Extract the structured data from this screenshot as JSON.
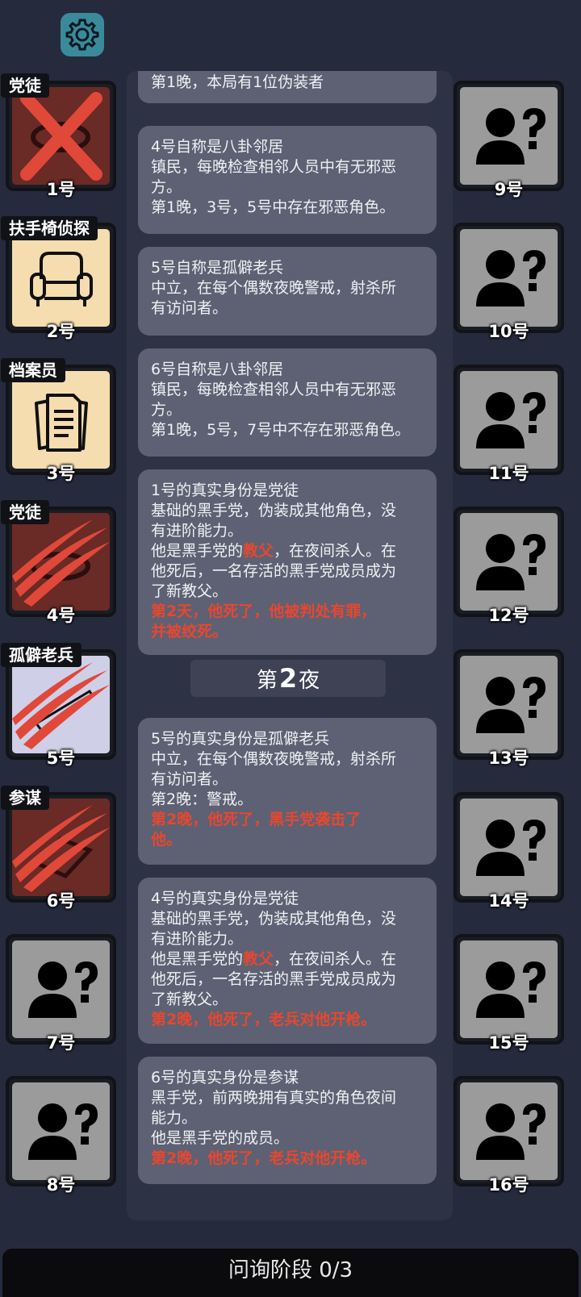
{
  "settings_icon": "gear-icon",
  "left_players": [
    {
      "num": "1号",
      "tag": "党徒",
      "status": "executed"
    },
    {
      "num": "2号",
      "tag": "扶手椅侦探",
      "status": "alive"
    },
    {
      "num": "3号",
      "tag": "档案员",
      "status": "alive"
    },
    {
      "num": "4号",
      "tag": "党徒",
      "status": "dead"
    },
    {
      "num": "5号",
      "tag": "孤僻老兵",
      "status": "dead"
    },
    {
      "num": "6号",
      "tag": "参谋",
      "status": "dead"
    },
    {
      "num": "7号",
      "tag": "",
      "status": "unknown"
    },
    {
      "num": "8号",
      "tag": "",
      "status": "unknown"
    }
  ],
  "right_players": [
    "9号",
    "10号",
    "11号",
    "12号",
    "13号",
    "14号",
    "15号",
    "16号"
  ],
  "messages": [
    {
      "lines": [
        "第1晚，本局有1位伪装者"
      ]
    },
    {
      "lines": [
        "4号自称是八卦邻居",
        "镇民，每晚检查相邻人员中有无邪恶",
        "方。",
        "第1晚，3号，5号中存在邪恶角色。"
      ]
    },
    {
      "lines": [
        "5号自称是孤僻老兵",
        "中立，在每个偶数夜晚警戒，射杀所",
        "有访问者。"
      ]
    },
    {
      "lines": [
        "6号自称是八卦邻居",
        "镇民，每晚检查相邻人员中有无邪恶",
        "方。",
        "第1晚，5号，7号中不存在邪恶角色。"
      ]
    },
    {
      "lines": [
        "1号的真实身份是党徒",
        "基础的黑手党，伪装成其他角色，没",
        "有进阶能力。"
      ],
      "l4a": "他是黑手党的",
      "l4b": "教父",
      "l4c": "，在夜间杀人。在",
      "l5": "他死后，一名存活的黑手党成员成为",
      "l6": "了新教父。",
      "red": [
        "第2天，他死了，他被判处有罪，",
        "并被绞死。"
      ]
    },
    {
      "lines": [
        "5号的真实身份是孤僻老兵",
        "中立，在每个偶数夜晚警戒，射杀所",
        "有访问者。",
        "第2晚：警戒。"
      ],
      "red": [
        "第2晚，他死了，黑手党袭击了",
        "他。"
      ]
    },
    {
      "lines": [
        "4号的真实身份是党徒",
        "基础的黑手党，伪装成其他角色，没",
        "有进阶能力。"
      ],
      "l4a": "他是黑手党的",
      "l4b": "教父",
      "l4c": "，在夜间杀人。在",
      "l5": "他死后，一名存活的黑手党成员成为",
      "l6": "了新教父。",
      "red": [
        "第2晚，他死了，老兵对他开枪。"
      ]
    },
    {
      "lines": [
        "6号的真实身份是参谋",
        "黑手党，前两晚拥有真实的角色夜间",
        "能力。",
        "他是黑手党的成员。"
      ],
      "red": [
        "第2晚，他死了，老兵对他开枪。"
      ]
    }
  ],
  "night_banner": {
    "prefix": "第",
    "number": "2",
    "suffix": "夜"
  },
  "bottom_bar": {
    "label": "问询阶段 0/3"
  },
  "colors": {
    "background": "#262a3d",
    "message_bg": "#5d6173",
    "highlight_red": "#e8472f",
    "gear_bg": "#3a8a9c"
  }
}
